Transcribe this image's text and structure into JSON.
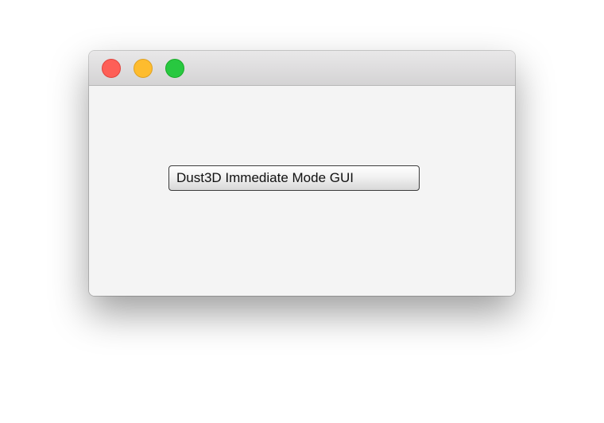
{
  "window": {
    "controls": {
      "close_color": "#fe5f57",
      "minimize_color": "#febc2e",
      "zoom_color": "#28c840"
    }
  },
  "content": {
    "button_label": "Dust3D Immediate Mode GUI"
  }
}
